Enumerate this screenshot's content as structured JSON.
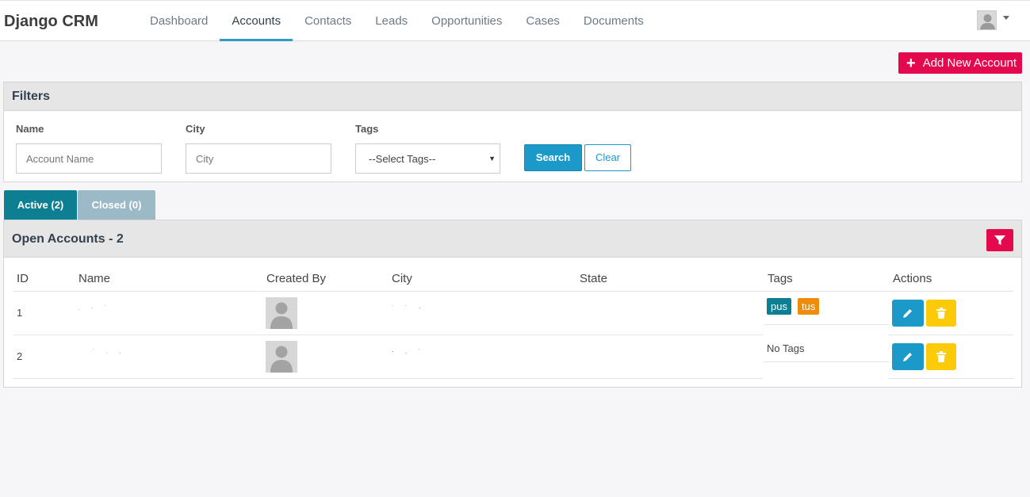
{
  "app": {
    "title": "Django CRM"
  },
  "nav": {
    "items": [
      {
        "label": "Dashboard"
      },
      {
        "label": "Accounts"
      },
      {
        "label": "Contacts"
      },
      {
        "label": "Leads"
      },
      {
        "label": "Opportunities"
      },
      {
        "label": "Cases"
      },
      {
        "label": "Documents"
      }
    ],
    "active": "Accounts"
  },
  "actions": {
    "add_label": "Add New Account"
  },
  "filters": {
    "title": "Filters",
    "name_label": "Name",
    "name_placeholder": "Account Name",
    "city_label": "City",
    "city_placeholder": "City",
    "tags_label": "Tags",
    "tags_selected": "--Select Tags--",
    "search_label": "Search",
    "clear_label": "Clear"
  },
  "tabs": [
    {
      "label": "Active (2)"
    },
    {
      "label": "Closed (0)"
    }
  ],
  "accounts": {
    "title": "Open Accounts - 2",
    "columns": [
      "ID",
      "Name",
      "Created By",
      "City",
      "State",
      "Tags",
      "Actions"
    ],
    "rows": [
      {
        "id": "1",
        "tags": [
          "pus",
          "tus"
        ],
        "no_tags": ""
      },
      {
        "id": "2",
        "tags": [],
        "no_tags": "No Tags"
      }
    ]
  },
  "colors": {
    "accent_red": "#e4084d",
    "accent_blue": "#1b9ac9",
    "tab_active": "#0c7f92",
    "tag_orange": "#f08c0c",
    "delete_yellow": "#fcca06"
  }
}
